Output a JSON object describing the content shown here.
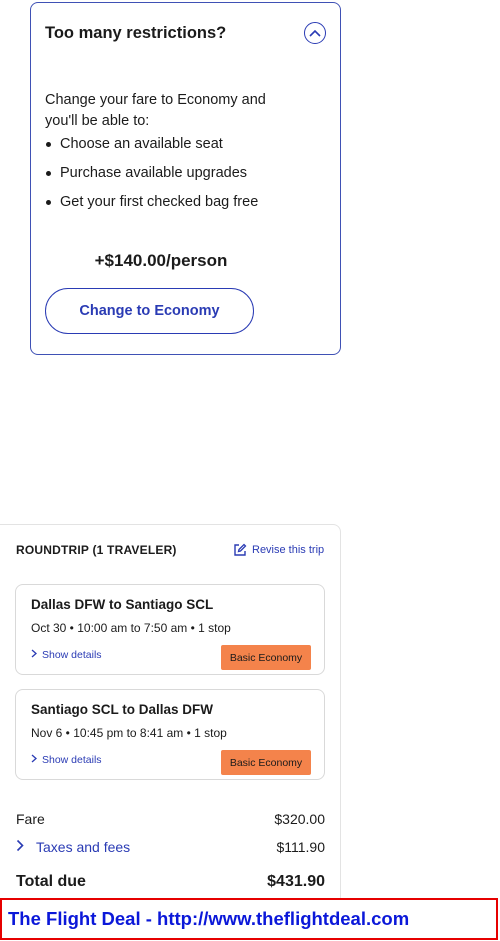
{
  "upsell": {
    "title": "Too many restrictions?",
    "intro": "Change your fare to Economy and you'll be able to:",
    "benefits": [
      "Choose an available seat",
      "Purchase available upgrades",
      "Get your first checked bag free"
    ],
    "price": "+$140.00/person",
    "cta_label": "Change to Economy",
    "collapse_icon": "chevron-up-icon"
  },
  "summary": {
    "heading": "ROUNDTRIP (1 TRAVELER)",
    "revise_label": "Revise this trip",
    "segments": [
      {
        "route": "Dallas DFW to Santiago SCL",
        "times": "Oct 30 • 10:00 am to 7:50 am • 1 stop",
        "details_label": "Show details",
        "fare_badge": "Basic Economy"
      },
      {
        "route": "Santiago SCL to Dallas DFW",
        "times": "Nov 6 • 10:45 pm to 8:41 am • 1 stop",
        "details_label": "Show details",
        "fare_badge": "Basic Economy"
      }
    ],
    "fare_label": "Fare",
    "fare_value": "$320.00",
    "taxes_label": "Taxes and fees",
    "taxes_value": "$111.90",
    "total_label": "Total due",
    "total_value": "$431.90"
  },
  "banner": {
    "text": "The Flight Deal - http://www.theflightdeal.com"
  },
  "colors": {
    "accent": "#2a3bb4",
    "card_border": "#3f51b5",
    "badge_bg": "#f4834b",
    "banner_border": "#e60000",
    "banner_text": "#0b18d9"
  }
}
